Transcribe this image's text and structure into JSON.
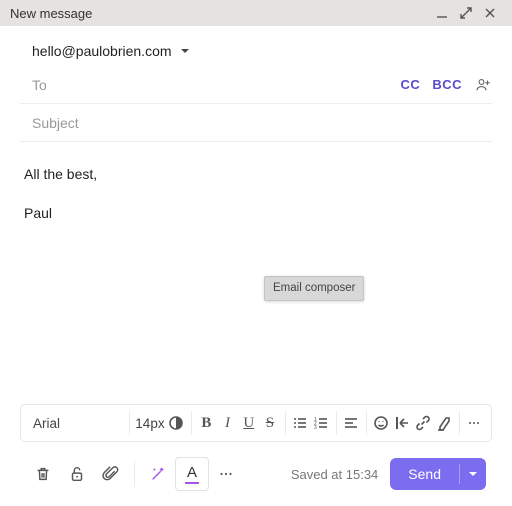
{
  "window": {
    "title": "New message"
  },
  "from": {
    "address": "hello@paulobrien.com"
  },
  "to": {
    "placeholder": "To",
    "cc_label": "CC",
    "bcc_label": "BCC"
  },
  "subject": {
    "placeholder": "Subject"
  },
  "body": {
    "line1": "All the best,",
    "line2": "Paul"
  },
  "tooltip": "Email composer",
  "format": {
    "font": "Arial",
    "size": "14px",
    "bold": "B",
    "italic": "I",
    "underline": "U",
    "strike": "S"
  },
  "textcolor_glyph": "A",
  "status": {
    "saved": "Saved at 15:34"
  },
  "send": {
    "label": "Send"
  }
}
